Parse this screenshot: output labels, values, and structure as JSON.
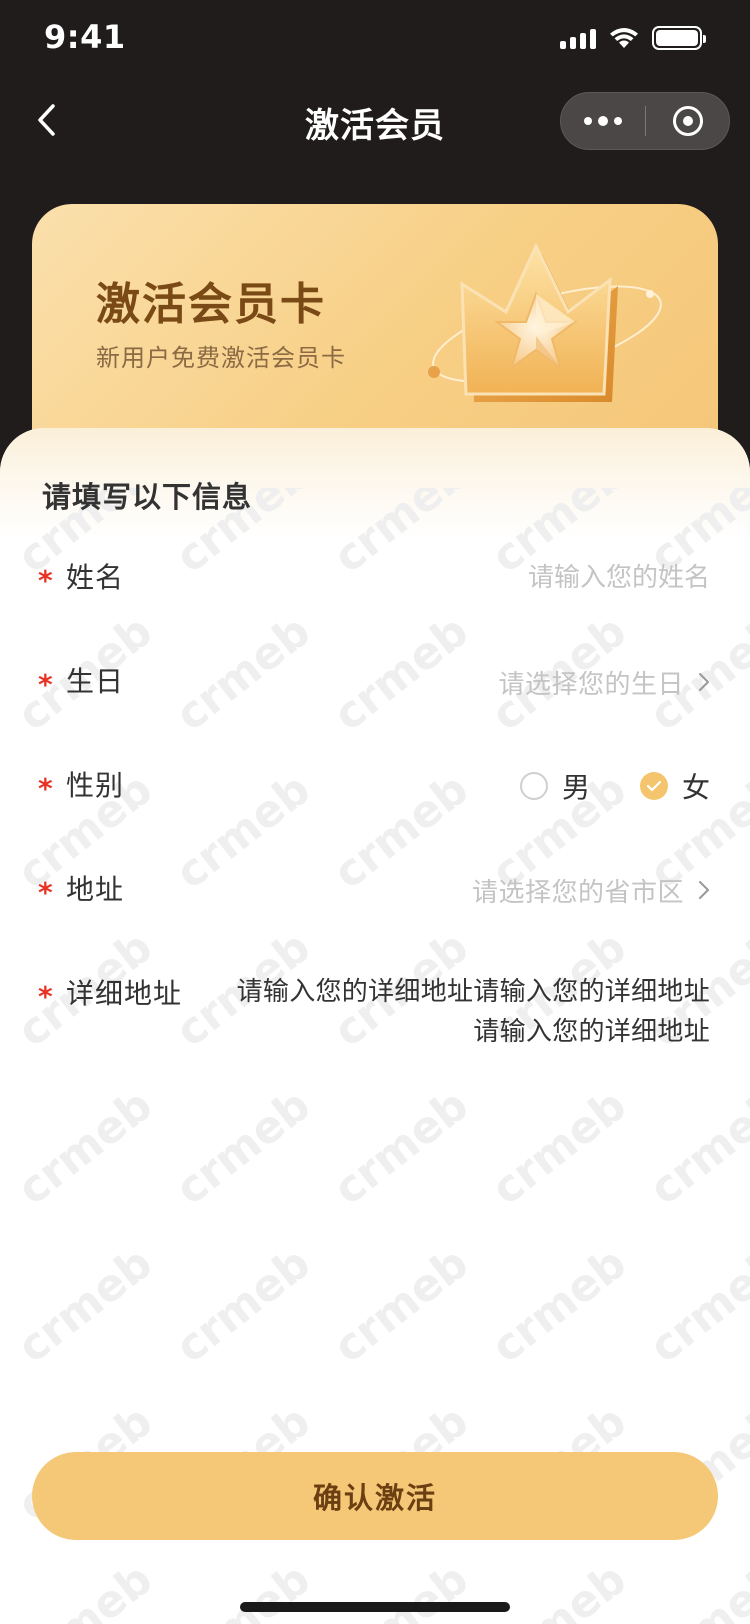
{
  "status_bar": {
    "time": "9:41"
  },
  "nav": {
    "title": "激活会员"
  },
  "card": {
    "title": "激活会员卡",
    "subtitle": "新用户免费激活会员卡",
    "accent_color": "#f5c877",
    "icon": "crown-star-icon"
  },
  "form": {
    "heading": "请填写以下信息",
    "required_mark": "*",
    "fields": {
      "name": {
        "label": "姓名",
        "placeholder": "请输入您的姓名"
      },
      "birthday": {
        "label": "生日",
        "placeholder": "请选择您的生日"
      },
      "gender": {
        "label": "性别",
        "options": [
          {
            "label": "男",
            "selected": false
          },
          {
            "label": "女",
            "selected": true
          }
        ]
      },
      "address": {
        "label": "地址",
        "placeholder": "请选择您的省市区"
      },
      "detail_address": {
        "label": "详细地址",
        "value": "请输入您的详细地址请输入您的详细地址请输入您的详细地址"
      }
    }
  },
  "confirm_button": {
    "label": "确认激活"
  },
  "colors": {
    "nav_background": "#1f1c1b",
    "required": "#e93323",
    "radio_selected": "#f4c56d",
    "button_text": "#6b3f12"
  }
}
